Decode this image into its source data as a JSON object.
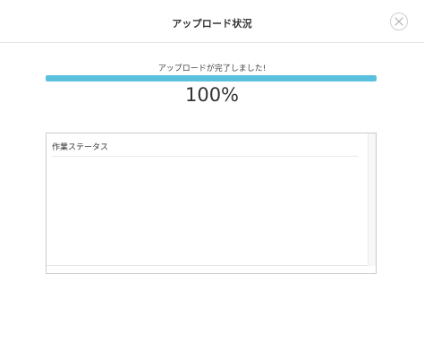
{
  "dialog": {
    "title": "アップロード状況",
    "close_icon": "close-icon"
  },
  "progress": {
    "message": "アップロードが完了しました!",
    "percent_label": "100%",
    "value": 100,
    "color": "#5bc0de"
  },
  "status_panel": {
    "heading": "作業ステータス",
    "items": []
  }
}
